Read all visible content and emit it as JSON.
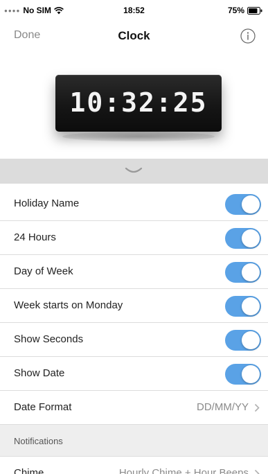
{
  "status_bar": {
    "carrier": "No SIM",
    "time": "18:52",
    "battery": "75%"
  },
  "nav": {
    "done_label": "Done",
    "title": "Clock",
    "info_icon": "info-icon"
  },
  "device": {
    "display_time": "10:32:25"
  },
  "settings": {
    "toggles": [
      {
        "label": "Holiday Name",
        "on": true
      },
      {
        "label": "24 Hours",
        "on": true
      },
      {
        "label": "Day of Week",
        "on": true
      },
      {
        "label": "Week starts on Monday",
        "on": true
      },
      {
        "label": "Show Seconds",
        "on": true
      },
      {
        "label": "Show Date",
        "on": true
      }
    ],
    "date_format": {
      "label": "Date Format",
      "value": "DD/MM/YY"
    },
    "notifications_header": "Notifications",
    "chime": {
      "label": "Chime",
      "value": "Hourly Chime + Hour Beeps"
    }
  },
  "colors": {
    "toggle_on": "#5aa2e6",
    "collapse_bar": "#dcdcdc"
  }
}
